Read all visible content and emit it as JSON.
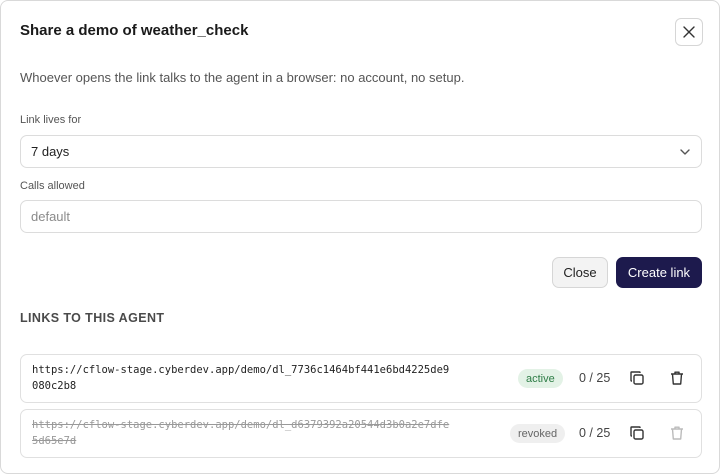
{
  "dialog": {
    "title": "Share a demo of weather_check",
    "description": "Whoever opens the link talks to the agent in a browser: no account, no setup."
  },
  "form": {
    "link_lives_label": "Link lives for",
    "link_lives_value": "7 days",
    "calls_allowed_label": "Calls allowed",
    "calls_allowed_placeholder": "default"
  },
  "buttons": {
    "close_label": "Close",
    "create_label": "Create link"
  },
  "links_section": {
    "heading": "LINKS TO THIS AGENT",
    "links": [
      {
        "url": "https://cflow-stage.cyberdev.app/demo/dl_7736c1464bf441e6bd4225de9080c2b8",
        "status": "active",
        "usage": "0 / 25"
      },
      {
        "url": "https://cflow-stage.cyberdev.app/demo/dl_d6379392a20544d3b0a2e7dfe5d65e7d",
        "status": "revoked",
        "usage": "0 / 25"
      }
    ]
  },
  "icons": {
    "close": "close-icon",
    "chevron": "chevron-down-icon",
    "copy": "copy-icon",
    "delete": "trash-icon"
  },
  "colors": {
    "primary_button": "#1d1a4d",
    "active_badge_bg": "#e3f2e6",
    "active_badge_text": "#2e7d46",
    "revoked_badge_bg": "#efefef"
  }
}
